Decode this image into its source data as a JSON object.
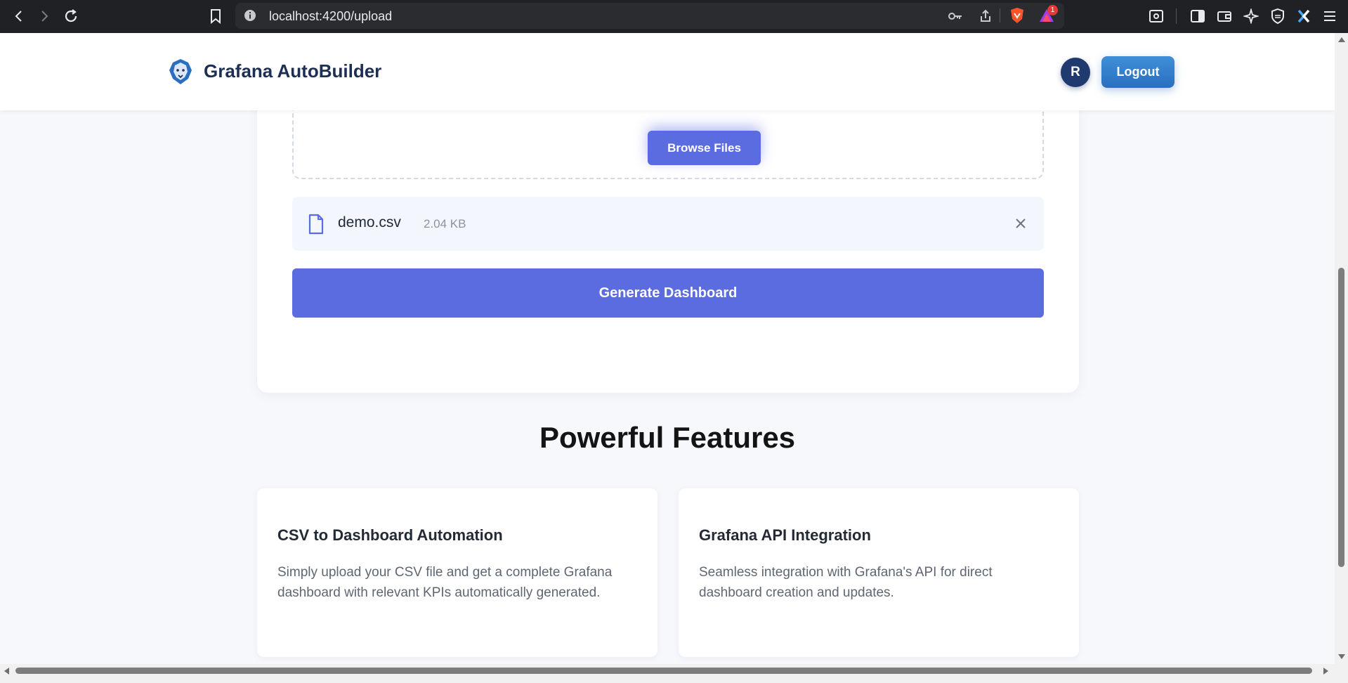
{
  "browser": {
    "url": "localhost:4200/upload",
    "notification_count": "1"
  },
  "header": {
    "brand_name": "Grafana AutoBuilder",
    "avatar_initial": "R",
    "logout_label": "Logout"
  },
  "upload": {
    "browse_label": "Browse Files",
    "file": {
      "name": "demo.csv",
      "size": "2.04 KB",
      "icon": "file-icon"
    },
    "generate_label": "Generate Dashboard"
  },
  "features": {
    "title": "Powerful Features",
    "items": [
      {
        "title": "CSV to Dashboard Automation",
        "description": "Simply upload your CSV file and get a complete Grafana dashboard with relevant KPIs automatically generated."
      },
      {
        "title": "Grafana API Integration",
        "description": "Seamless integration with Grafana's API for direct dashboard creation and updates."
      }
    ]
  },
  "colors": {
    "accent": "#5b6be0",
    "brand_dark": "#1e2f55",
    "logout": "#2a6fbf"
  }
}
